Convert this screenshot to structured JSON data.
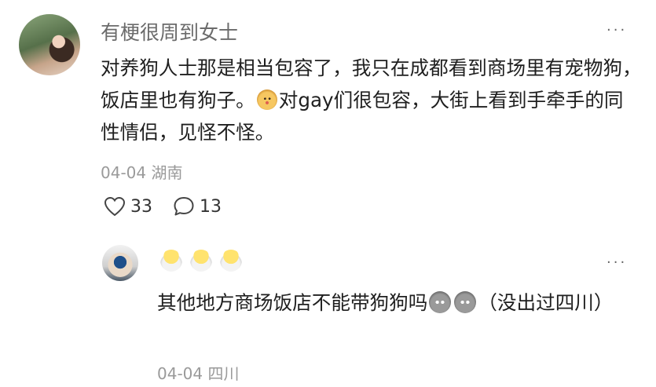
{
  "comment": {
    "username": "有梗很周到女士",
    "text_part1": "对养狗人士那是相当包容了，我只在成都看到商场里有宠物狗，饭店里也有狗子。",
    "text_part2": "对gay们很包容，大街上看到手牵手的同性情侣，见怪不怪。",
    "emoji_icon": "bun-face-emoji",
    "date": "04-04",
    "location": "湖南",
    "likes": "33",
    "replies": "13",
    "more_label": "···"
  },
  "reply": {
    "username_icons": [
      "chick-emoji",
      "chick-emoji",
      "chick-emoji"
    ],
    "text_part1": "其他地方商场饭店不能带狗狗吗",
    "text_part2": "（没出过四川）",
    "emoji_icon": "gray-face-emoji",
    "date": "04-04",
    "location": "四川",
    "more_label": "···"
  }
}
